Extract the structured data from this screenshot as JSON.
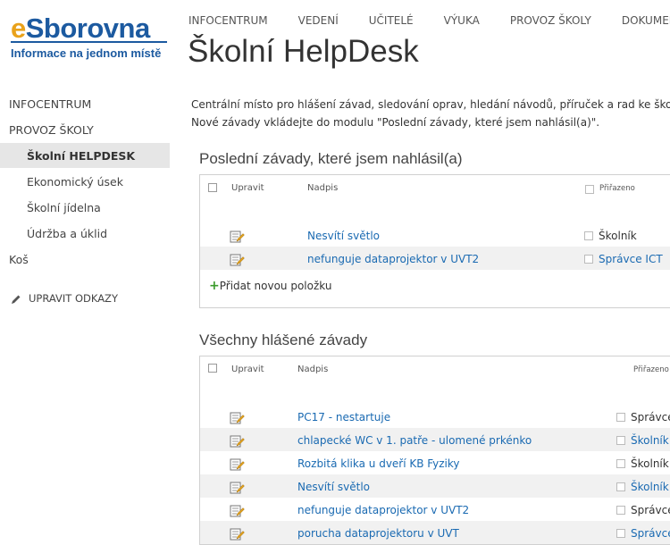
{
  "logo": {
    "e": "e",
    "rest": "Sborovna",
    "tagline": "Informace na jednom místě"
  },
  "topnav": [
    "INFOCENTRUM",
    "VEDENÍ",
    "UČITELÉ",
    "VÝUKA",
    "PROVOZ ŠKOLY",
    "DOKUMENTY"
  ],
  "page_title": "Školní HelpDesk",
  "leftnav": {
    "items": [
      "INFOCENTRUM",
      "PROVOZ ŠKOLY",
      "Školní HELPDESK",
      "Ekonomický úsek",
      "Školní jídelna",
      "Údržba a úklid",
      "Koš"
    ],
    "selected": "Školní HELPDESK",
    "edit_links": "UPRAVIT ODKAZY"
  },
  "description": {
    "line1": "Centrální místo pro hlášení závad, sledování oprav, hledání návodů, příruček a rad ke školní",
    "line2": "Nové závady vkládejte do modulu \"Poslední závady, které jsem nahlásil(a)\"."
  },
  "my_issues": {
    "title": "Poslední závady, které jsem nahlásil(a)",
    "headers": {
      "edit": "Upravit",
      "title": "Nadpis",
      "assigned": "Přiřazeno"
    },
    "rows": [
      {
        "title": "Nesvítí světlo",
        "assigned": "Školník",
        "assigned_link": false
      },
      {
        "title": "nefunguje dataprojektor v UVT2",
        "assigned": "Správce ICT",
        "assigned_link": true
      }
    ],
    "add_label": "Přidat novou položku"
  },
  "all_issues": {
    "title": "Všechny hlášené závady",
    "headers": {
      "edit": "Upravit",
      "title": "Nadpis",
      "assigned": "Přiřazeno"
    },
    "rows": [
      {
        "title": "PC17 - nestartuje",
        "assigned": "Správce",
        "assigned_link": false
      },
      {
        "title": "chlapecké WC v 1. patře - ulomené prkénko",
        "assigned": "Školník",
        "assigned_link": true
      },
      {
        "title": "Rozbitá klika u dveří KB Fyziky",
        "assigned": "Školník",
        "assigned_link": false
      },
      {
        "title": "Nesvítí světlo",
        "assigned": "Školník",
        "assigned_link": true
      },
      {
        "title": "nefunguje dataprojektor v UVT2",
        "assigned": "Správce",
        "assigned_link": false
      },
      {
        "title": "porucha dataprojektoru v UVT",
        "assigned": "Správce",
        "assigned_link": true
      }
    ]
  },
  "colors": {
    "brand_blue": "#1c5aa0",
    "brand_orange": "#e9a21b",
    "link": "#1a6ab2",
    "selected_bg": "#e6e6e6"
  },
  "icons": [
    "edit-item-icon",
    "pencil-icon",
    "plus-icon",
    "checkbox"
  ]
}
